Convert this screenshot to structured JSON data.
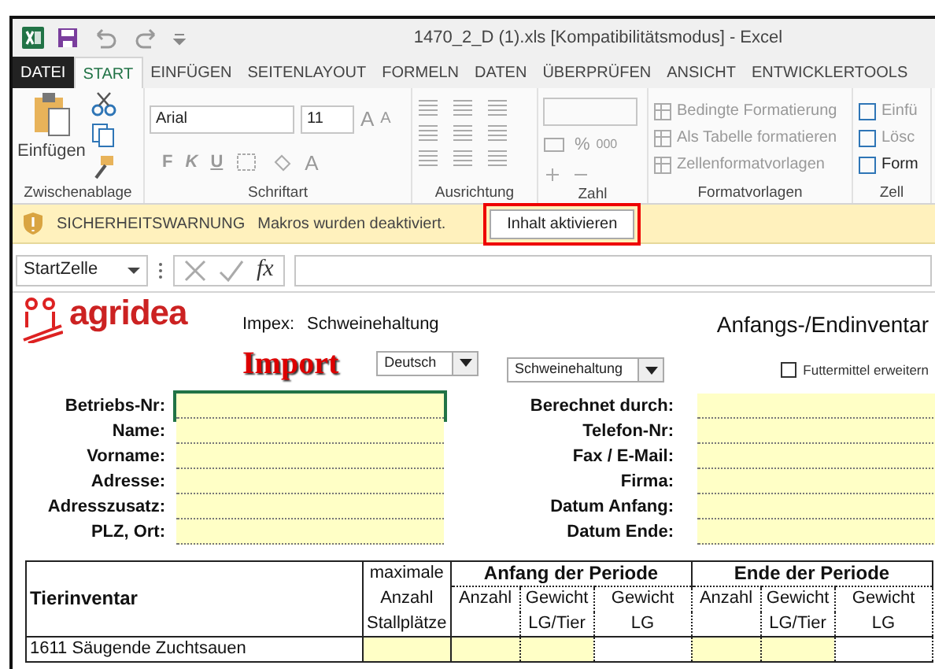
{
  "window": {
    "title": "1470_2_D (1).xls  [Kompatibilitätsmodus] - Excel"
  },
  "tabs": [
    {
      "label": "DATEI",
      "kind": "file",
      "selected": false
    },
    {
      "label": "START",
      "kind": "tab",
      "selected": true
    },
    {
      "label": "EINFÜGEN",
      "kind": "tab",
      "selected": false
    },
    {
      "label": "SEITENLAYOUT",
      "kind": "tab",
      "selected": false
    },
    {
      "label": "FORMELN",
      "kind": "tab",
      "selected": false
    },
    {
      "label": "DATEN",
      "kind": "tab",
      "selected": false
    },
    {
      "label": "ÜBERPRÜFEN",
      "kind": "tab",
      "selected": false
    },
    {
      "label": "ANSICHT",
      "kind": "tab",
      "selected": false
    },
    {
      "label": "ENTWICKLERTOOLS",
      "kind": "tab",
      "selected": false
    }
  ],
  "ribbon": {
    "clipboard": {
      "paste": "Einfügen",
      "label": "Zwischenablage"
    },
    "font": {
      "name": "Arial",
      "size": "11",
      "grow": "A",
      "shrink": "A",
      "styles": [
        "F",
        "K",
        "U"
      ],
      "font_color_button": "A",
      "label": "Schriftart"
    },
    "alignment": {
      "label": "Ausrichtung"
    },
    "number": {
      "percent": "%",
      "thousands": "000",
      "label": "Zahl"
    },
    "styles": {
      "items": [
        "Bedingte Formatierung",
        "Als Tabelle formatieren",
        "Zellenformatvorlagen"
      ],
      "label": "Formatvorlagen"
    },
    "cells": {
      "items": [
        "Einfü",
        "Lösc",
        "Form"
      ],
      "label": "Zell"
    }
  },
  "warning": {
    "title": "SICHERHEITSWARNUNG",
    "message": "Makros wurden deaktiviert.",
    "button": "Inhalt aktivieren"
  },
  "formula_bar": {
    "name_box": "StartZelle",
    "fx": "fx"
  },
  "sheet": {
    "logo": "agridea",
    "impex_label": "Impex:",
    "impex_value": "Schweinehaltung",
    "import": "Import",
    "language": "Deutsch",
    "category": "Schweinehaltung",
    "title": "Anfangs-/Endinventar",
    "feed_checkbox": {
      "label": "Futtermittel erweitern",
      "checked": false
    },
    "left_fields": [
      "Betriebs-Nr:",
      "Name:",
      "Vorname:",
      "Adresse:",
      "Adresszusatz:",
      "PLZ, Ort:"
    ],
    "right_fields": [
      "Berechnet durch:",
      "Telefon-Nr:",
      "Fax / E-Mail:",
      "Firma:",
      "Datum Anfang:",
      "Datum Ende:"
    ],
    "table": {
      "title": "Tierinventar",
      "max_places": [
        "maximale",
        "Anzahl",
        "Stallplätze"
      ],
      "start_group": "Anfang der Periode",
      "end_group": "Ende der Periode",
      "start_sub": [
        [
          "Anzahl"
        ],
        [
          "Gewicht",
          "LG/Tier"
        ],
        [
          "Gewicht",
          "LG"
        ]
      ],
      "end_sub": [
        [
          "Anzahl"
        ],
        [
          "Gewicht",
          "LG/Tier"
        ],
        [
          "Gewicht",
          "LG"
        ]
      ],
      "first_row": "1611  Säugende Zuchtsauen"
    }
  }
}
